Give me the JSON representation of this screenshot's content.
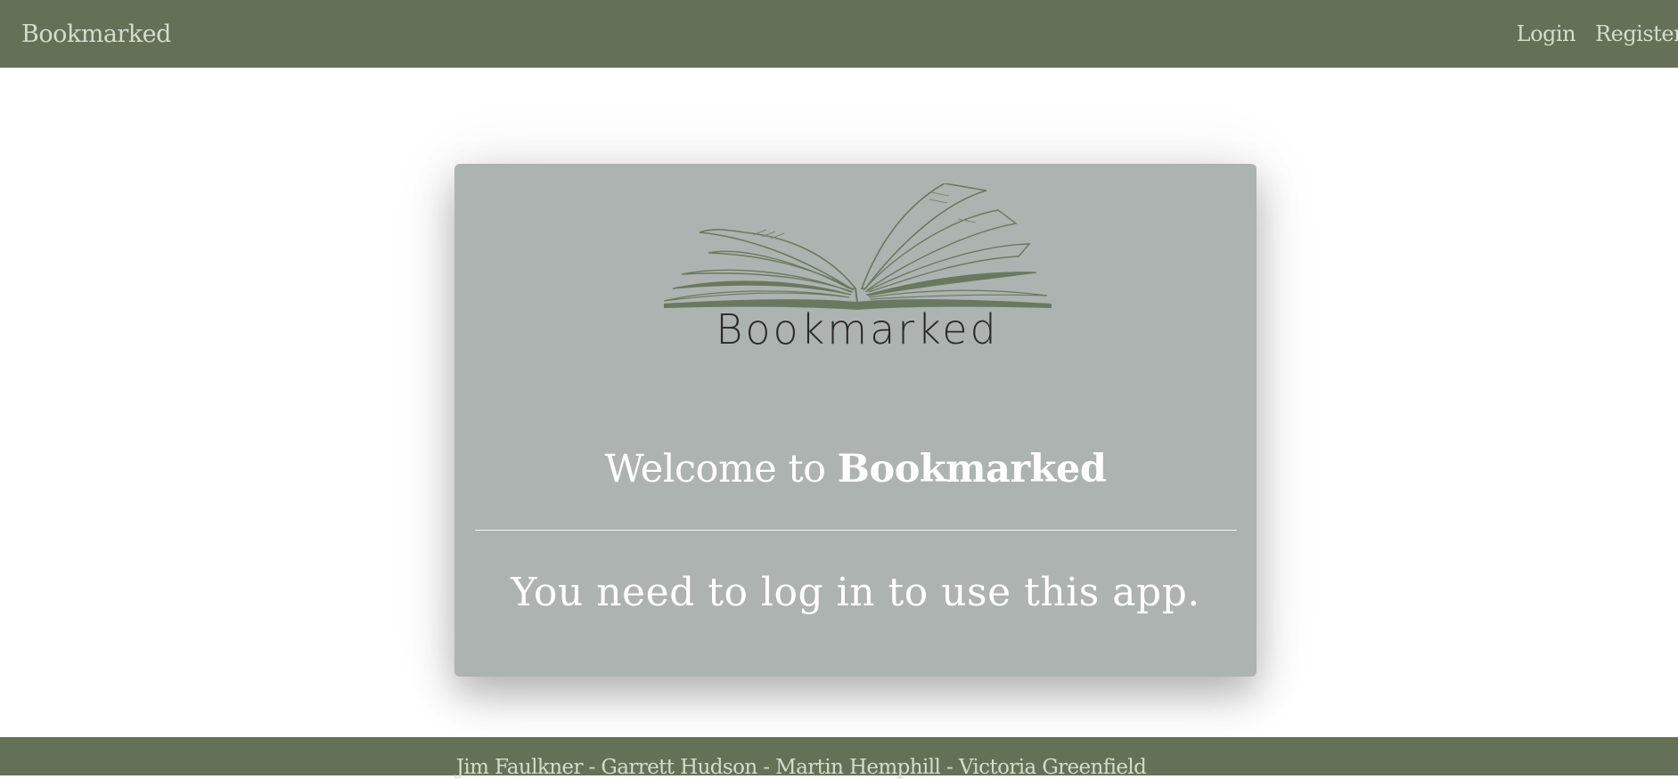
{
  "navbar": {
    "brand": "Bookmarked",
    "login_label": "Login",
    "register_label": "Register"
  },
  "card": {
    "logo_text": "Bookmarked",
    "welcome_prefix": "Welcome to ",
    "welcome_brand": "Bookmarked",
    "message": "You need to log in to use this app."
  },
  "footer": {
    "credits": "Jim Faulkner - Garrett Hudson - Martin Hemphill - Victoria Greenfield"
  },
  "colors": {
    "accent": "#647156",
    "card": "#adb3b0"
  }
}
